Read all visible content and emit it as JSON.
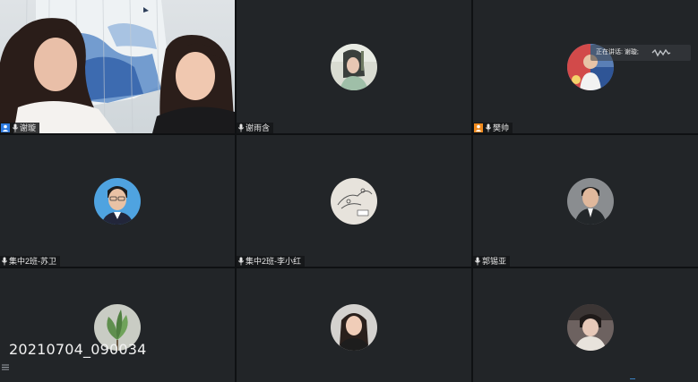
{
  "participants": [
    {
      "name": "谢璇",
      "role": "host",
      "video": true
    },
    {
      "name": "谢雨含"
    },
    {
      "name": "樊帅",
      "role": "host"
    },
    {
      "name": "集中2班-苏卫"
    },
    {
      "name": "集中2班-李小红"
    },
    {
      "name": "郭锡亚"
    },
    {
      "name": ""
    },
    {
      "name": ""
    },
    {
      "name": ""
    }
  ],
  "speaking_indicator": {
    "text": "正在讲话: 谢璇;"
  },
  "recording_timestamp": "20210704_090034",
  "colors": {
    "tile_bg": "#222528",
    "host_badge_blue": "#2f7be0",
    "host_badge_orange": "#f08a1d",
    "text": "#e6e6e6"
  },
  "icons": [
    "mic-icon",
    "user-badge-icon",
    "menu-icon",
    "sound-wave-icon"
  ]
}
